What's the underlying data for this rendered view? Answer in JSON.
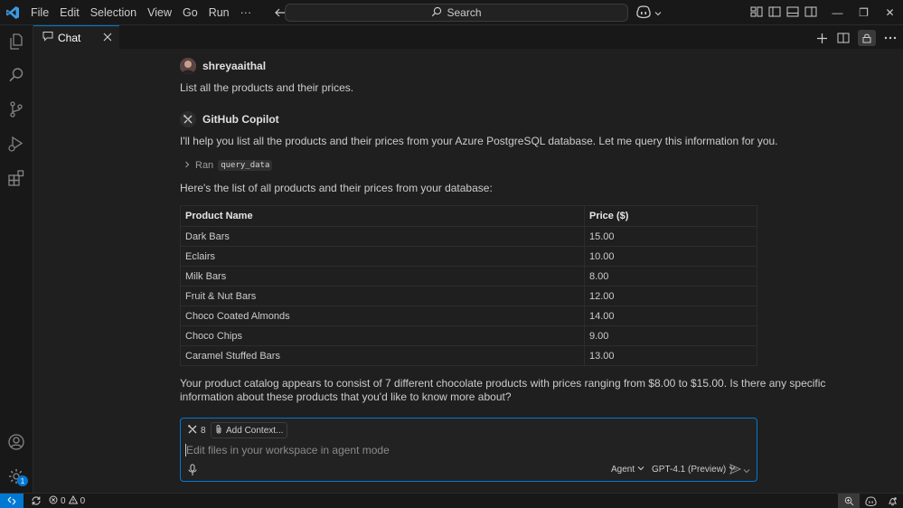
{
  "menu": [
    "File",
    "Edit",
    "Selection",
    "View",
    "Go",
    "Run",
    "···"
  ],
  "search": {
    "label": "Search"
  },
  "tab": {
    "label": "Chat"
  },
  "user_message": {
    "author": "shreyaaithal",
    "text": "List all the products and their prices."
  },
  "assistant_message": {
    "author": "GitHub Copilot",
    "intro": "I'll help you list all the products and their prices from your Azure PostgreSQL database. Let me query this information for you.",
    "ran_label": "Ran",
    "tool_name": "query_data",
    "lead": "Here's the list of all products and their prices from your database:",
    "table": {
      "headers": [
        "Product Name",
        "Price ($)"
      ],
      "rows": [
        [
          "Dark Bars",
          "15.00"
        ],
        [
          "Eclairs",
          "10.00"
        ],
        [
          "Milk Bars",
          "8.00"
        ],
        [
          "Fruit & Nut Bars",
          "12.00"
        ],
        [
          "Choco Coated Almonds",
          "14.00"
        ],
        [
          "Choco Chips",
          "9.00"
        ],
        [
          "Caramel Stuffed Bars",
          "13.00"
        ]
      ]
    },
    "summary_line1": "Your product catalog appears to consist of 7 different chocolate products with prices ranging from $8.00 to $15.00. Is there any specific",
    "summary_line2": "information about these products that you'd like to know more about?"
  },
  "input": {
    "tools_count": "8",
    "add_context": "Add Context...",
    "placeholder": "Edit files in your workspace in agent mode",
    "mode": "Agent",
    "model": "GPT-4.1 (Preview)"
  },
  "status": {
    "errors": "0",
    "warnings": "0",
    "accounts_badge": "1"
  },
  "colors": {
    "accent": "#0078d4",
    "background": "#1f1f1f",
    "chrome": "#181818"
  }
}
